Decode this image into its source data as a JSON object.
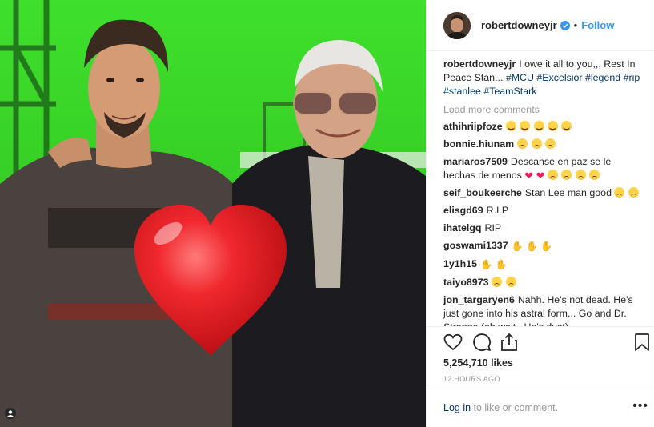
{
  "post": {
    "username": "robertdowneyjr",
    "follow_label": "Follow",
    "separator": "•",
    "caption_text": "I owe it all to you,,, Rest In Peace Stan... ",
    "hashtags": [
      "#MCU",
      "#Excelsior",
      "#legend",
      "#rip",
      "#stanlee",
      "#TeamStark"
    ],
    "load_more": "Load more comments",
    "likes": "5,254,710 likes",
    "time": "12 HOURS AGO",
    "login_link": "Log in",
    "login_suffix": " to like or comment.",
    "more_label": "•••"
  },
  "comments": [
    {
      "user": "athihriipfoze",
      "text": "",
      "emoji": [
        "cry",
        "cry",
        "cry",
        "cry",
        "cry"
      ]
    },
    {
      "user": "bonnie.hiunam",
      "text": "",
      "emoji": [
        "sad",
        "sad",
        "sad"
      ]
    },
    {
      "user": "mariaros7509",
      "text": "Descanse en paz se le hechas de menos",
      "emoji": [
        "heart",
        "heart",
        "sad",
        "sad",
        "sad",
        "sad"
      ]
    },
    {
      "user": "seif_boukeerche",
      "text": "Stan Lee man good",
      "emoji": [
        "sad",
        "sad"
      ]
    },
    {
      "user": "elisgd69",
      "text": "R.I.P",
      "emoji": []
    },
    {
      "user": "ihatelgq",
      "text": "RIP",
      "emoji": []
    },
    {
      "user": "goswami1337",
      "text": "",
      "emoji": [
        "hands",
        "hands",
        "hands"
      ]
    },
    {
      "user": "1y1h15",
      "text": "",
      "emoji": [
        "hands",
        "hands"
      ]
    },
    {
      "user": "taiyo8973",
      "text": "",
      "emoji": [
        "sad",
        "sad"
      ]
    },
    {
      "user": "jon_targaryen6",
      "text": "Nahh. He's not dead. He's just gone into his astral form... Go and Dr. Strange (oh wait.. He's dust)",
      "emoji": []
    }
  ],
  "icons": {
    "heart": "heart-icon",
    "comment": "comment-icon",
    "share": "share-icon",
    "bookmark": "bookmark-icon",
    "verified": "verified-badge-icon"
  },
  "colors": {
    "accent": "#3897f0",
    "hashtag": "#003569",
    "muted": "#999999",
    "greenscreen": "#41d62e",
    "big_heart": "#e8171f"
  }
}
